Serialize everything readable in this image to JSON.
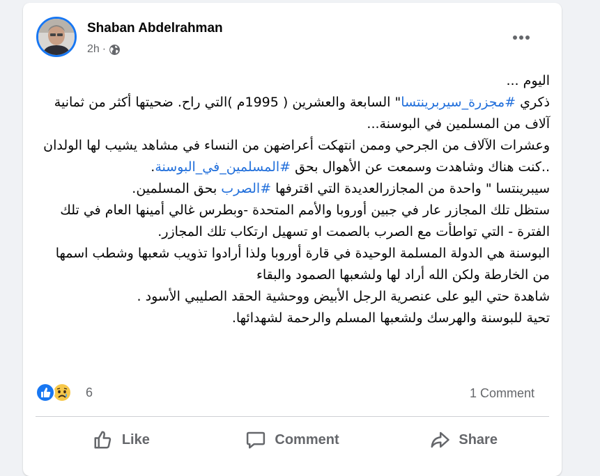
{
  "post": {
    "author": "Shaban Abdelrahman",
    "time": "2h",
    "separator": "·",
    "more_label": "•••",
    "paragraphs": [
      {
        "segments": [
          {
            "text": "اليوم ...",
            "tag": false
          }
        ]
      },
      {
        "segments": [
          {
            "text": "ذكري ",
            "tag": false
          },
          {
            "text": "#مجزرة_سيربرينتسا",
            "tag": true
          },
          {
            "text": "\" السابعة والعشرين ( 1995م )التي راح. ضحيتها أكثر من ثمانية آلاف من المسلمين في البوسنة...",
            "tag": false
          }
        ]
      },
      {
        "segments": [
          {
            "text": "وعشرات الآلاف من الجرحي وممن  انتهكت أعراضهن من النساء في مشاهد يشيب لها الولدان ..كنت هناك وشاهدت وسمعت عن الأهوال بحق ",
            "tag": false
          },
          {
            "text": "#المسلمين_في_البوسنة",
            "tag": true
          },
          {
            "text": ".",
            "tag": false
          }
        ]
      },
      {
        "segments": [
          {
            "text": "سيبرينتسا \" واحدة من المجازرالعديدة التي اقترفها ",
            "tag": false
          },
          {
            "text": "#الصرب",
            "tag": true
          },
          {
            "text": " بحق المسلمين.",
            "tag": false
          }
        ]
      },
      {
        "segments": [
          {
            "text": "ستظل تلك المجازر عار  في جبين أوروبا والأمم المتحدة  -وبطرس غالي أمينها العام في تلك الفترة - التي تواطأت مع الصرب بالصمت او تسهيل ارتكاب تلك المجازر.",
            "tag": false
          }
        ]
      },
      {
        "segments": [
          {
            "text": "البوسنة هي الدولة المسلمة الوحيدة في قارة  أوروبا ولذا أرادوا تذويب شعبها وشطب اسمها من الخارطة ولكن الله أراد لها ولشعبها الصمود والبقاء￼",
            "tag": false
          }
        ]
      },
      {
        "segments": [
          {
            "text": "شاهدة حتي اليو على عنصرية الرجل الأبيض ووحشية الحقد الصليبي الأسود .",
            "tag": false
          }
        ]
      },
      {
        "segments": [
          {
            "text": "تحية للبوسنة والهرسك ولشعبها المسلم والرحمة لشهدائها.",
            "tag": false
          }
        ]
      }
    ]
  },
  "reactions": {
    "count": "6",
    "types": [
      "like",
      "sad"
    ]
  },
  "comments": {
    "count_label": "1 Comment"
  },
  "actions": {
    "like": "Like",
    "comment": "Comment",
    "share": "Share"
  },
  "icons": {
    "avatar": "avatar-photo",
    "privacy": "globe-icon",
    "like": "thumbs-up-icon",
    "comment": "comment-bubble-icon",
    "share": "share-arrow-icon"
  },
  "colors": {
    "accent": "#1877f2",
    "hashtag": "#216fdb",
    "muted": "#65676b"
  }
}
